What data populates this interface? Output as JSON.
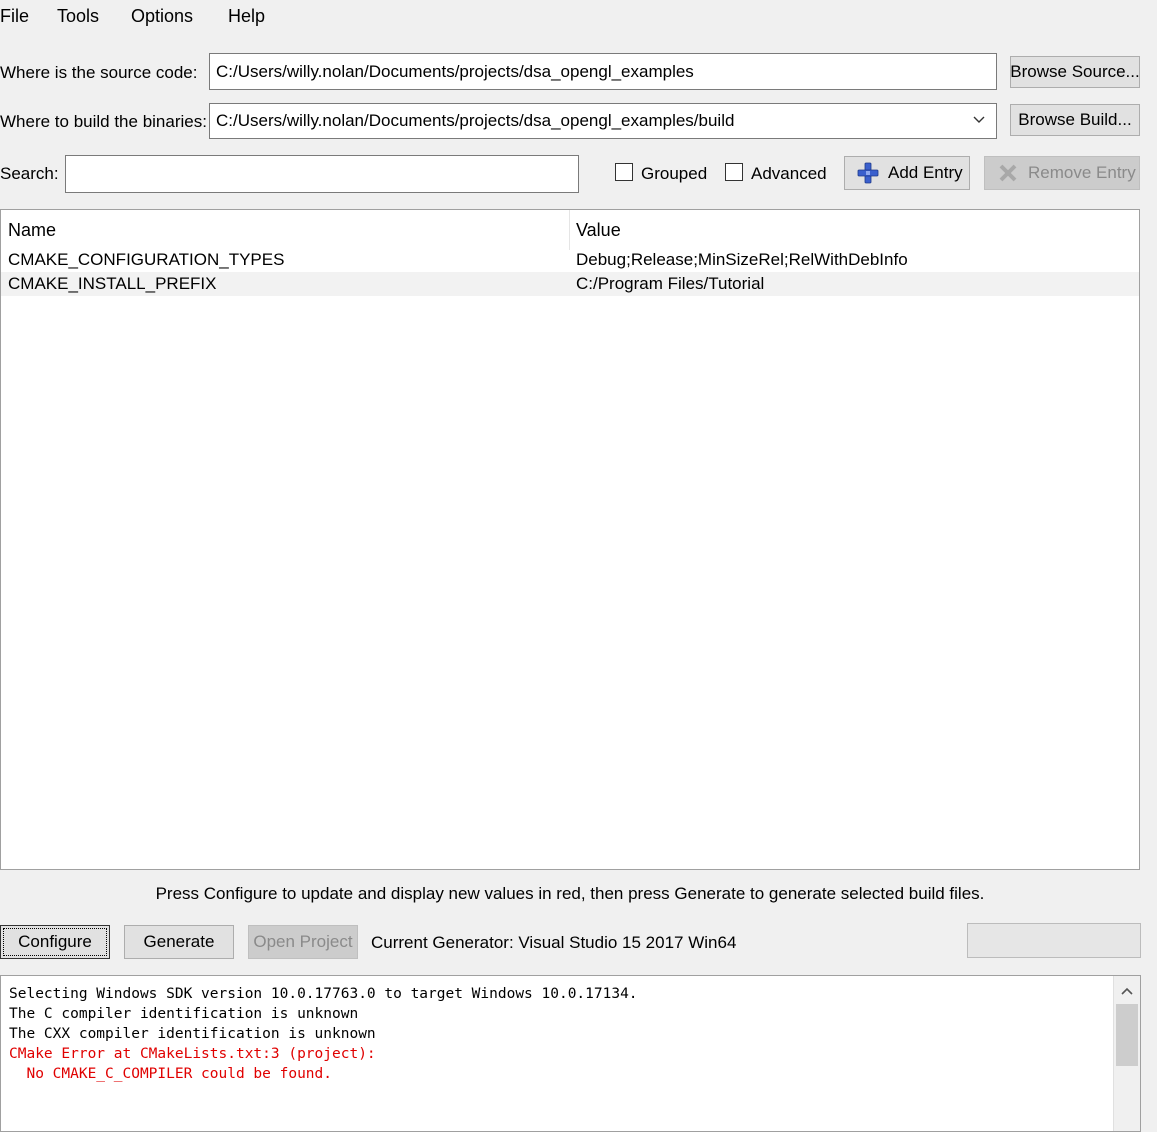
{
  "menu": {
    "file": "File",
    "tools": "Tools",
    "options": "Options",
    "help": "Help"
  },
  "source": {
    "label": "Where is the source code:",
    "value": "C:/Users/willy.nolan/Documents/projects/dsa_opengl_examples",
    "browse_label": "Browse Source..."
  },
  "build": {
    "label": "Where to build the binaries:",
    "value": "C:/Users/willy.nolan/Documents/projects/dsa_opengl_examples/build",
    "browse_label": "Browse Build..."
  },
  "search": {
    "label": "Search:",
    "value": ""
  },
  "toggles": {
    "grouped": "Grouped",
    "advanced": "Advanced"
  },
  "actions": {
    "add_entry": "Add Entry",
    "remove_entry": "Remove Entry"
  },
  "table": {
    "headers": {
      "name": "Name",
      "value": "Value"
    },
    "rows": [
      {
        "name": "CMAKE_CONFIGURATION_TYPES",
        "value": "Debug;Release;MinSizeRel;RelWithDebInfo"
      },
      {
        "name": "CMAKE_INSTALL_PREFIX",
        "value": "C:/Program Files/Tutorial"
      }
    ]
  },
  "hint": "Press Configure to update and display new values in red, then press Generate to generate selected build files.",
  "bottom": {
    "configure": "Configure",
    "generate": "Generate",
    "open_project": "Open Project",
    "generator": "Current Generator: Visual Studio 15 2017 Win64"
  },
  "output": {
    "lines": [
      {
        "text": "Selecting Windows SDK version 10.0.17763.0 to target Windows 10.0.17134.",
        "error": false
      },
      {
        "text": "The C compiler identification is unknown",
        "error": false
      },
      {
        "text": "The CXX compiler identification is unknown",
        "error": false
      },
      {
        "text": "CMake Error at CMakeLists.txt:3 (project):",
        "error": true
      },
      {
        "text": "  No CMAKE_C_COMPILER could be found.",
        "error": true
      }
    ]
  },
  "colors": {
    "error": "#e00000",
    "add_icon": "#3a5fcd"
  }
}
